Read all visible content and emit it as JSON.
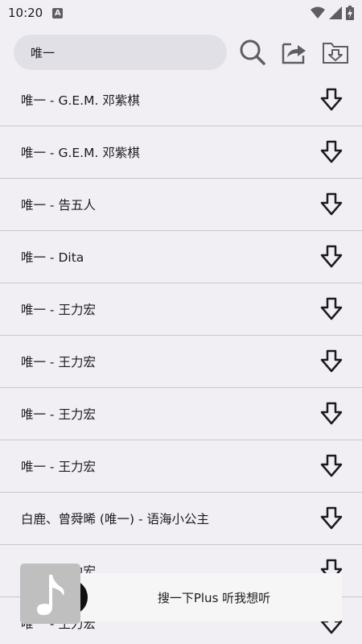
{
  "status_bar": {
    "time": "10:20",
    "notification_glyph": "A"
  },
  "search": {
    "value": "唯一"
  },
  "toolbar": {
    "icons": [
      "search-icon",
      "share-icon",
      "download-folder-icon"
    ]
  },
  "songs": [
    {
      "title": "唯一 - G.E.M. 邓紫棋"
    },
    {
      "title": "唯一 - G.E.M. 邓紫棋"
    },
    {
      "title": "唯一 - 告五人"
    },
    {
      "title": "唯一 - Dita"
    },
    {
      "title": "唯一 - 王力宏"
    },
    {
      "title": "唯一 - 王力宏"
    },
    {
      "title": "唯一 - 王力宏"
    },
    {
      "title": "唯一 - 王力宏"
    },
    {
      "title": "白鹿、曾舜晞 (唯一) - 语海小公主"
    },
    {
      "title": "唯一 - 王力宏"
    },
    {
      "title": "唯一 - 王力宏"
    }
  ],
  "player": {
    "text": "搜一下Plus 听我想听",
    "cover_icon": "music-note-icon"
  },
  "colors": {
    "background": "#f1eff4",
    "search_fill": "#e2e0e7",
    "divider": "#c9c7cc",
    "icon": "#1b1b1f"
  }
}
